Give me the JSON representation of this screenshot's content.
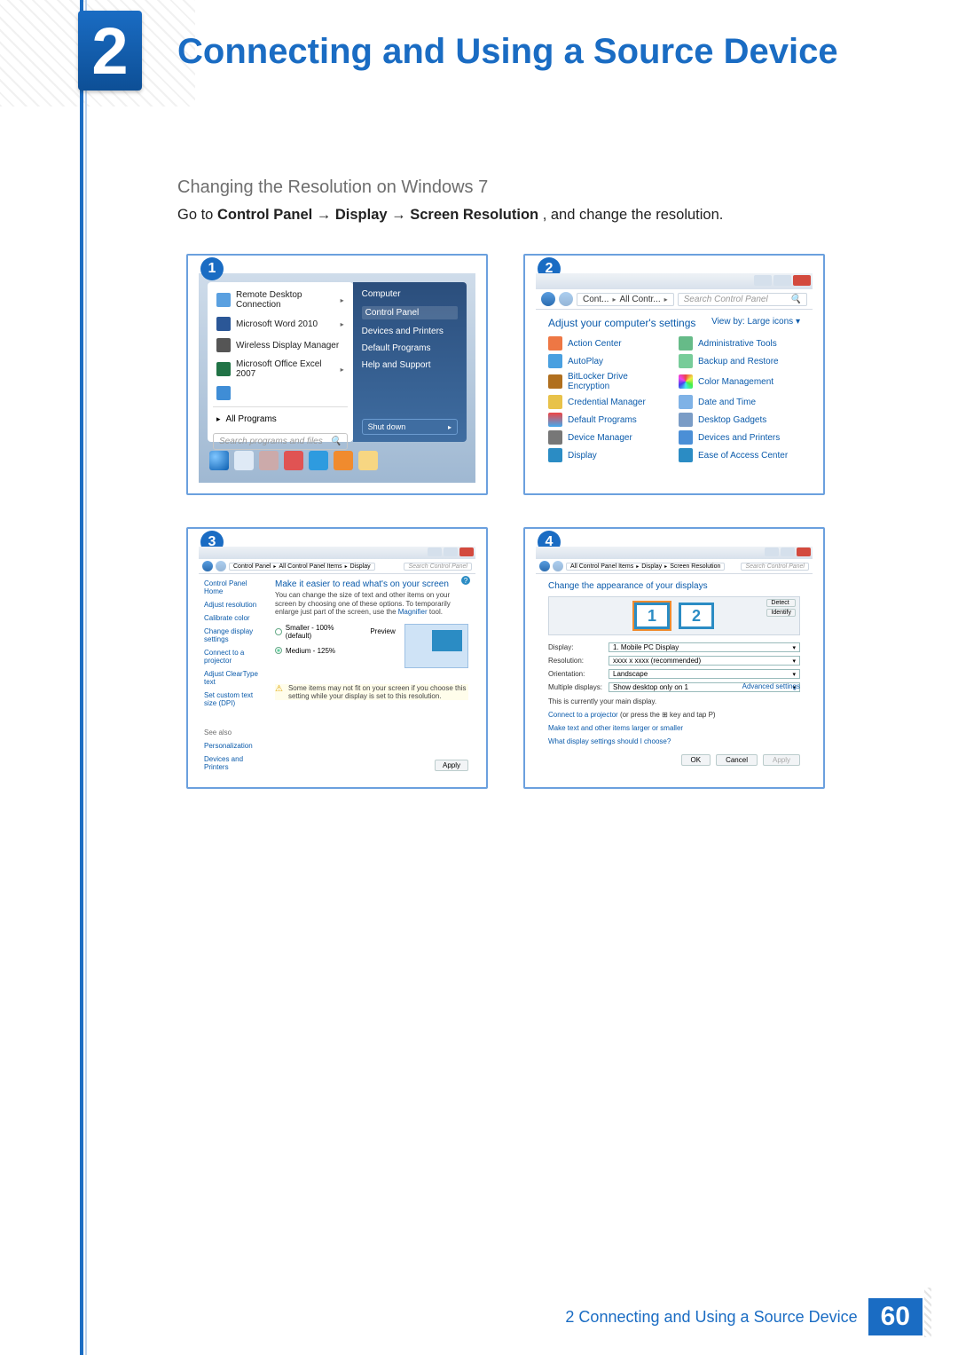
{
  "chapter": {
    "number": "2",
    "title": "Connecting and Using a Source Device"
  },
  "section": {
    "heading": "Changing the Resolution on Windows 7",
    "instruction_prefix": "Go to ",
    "instruction_bold": "Control Panel → Display → Screen Resolution",
    "instruction_suffix": ", and change the resolution."
  },
  "steps": {
    "s1": {
      "num": "1",
      "menu_items": [
        "Remote Desktop Connection",
        "Microsoft Word 2010",
        "Wireless Display Manager",
        "Microsoft Office Excel 2007"
      ],
      "all_programs": "All Programs",
      "search_placeholder": "Search programs and files",
      "right_items": [
        "Computer",
        "Control Panel",
        "Devices and Printers",
        "Default Programs",
        "Help and Support"
      ],
      "shutdown": "Shut down"
    },
    "s2": {
      "num": "2",
      "path": [
        "Cont...",
        "All Contr..."
      ],
      "search_placeholder": "Search Control Panel",
      "title": "Adjust your computer's settings",
      "view_label": "View by:",
      "view_value": "Large icons",
      "items": [
        "Action Center",
        "Administrative Tools",
        "AutoPlay",
        "Backup and Restore",
        "BitLocker Drive Encryption",
        "Color Management",
        "Credential Manager",
        "Date and Time",
        "Default Programs",
        "Desktop Gadgets",
        "Device Manager",
        "Devices and Printers",
        "Display",
        "Ease of Access Center"
      ]
    },
    "s3": {
      "num": "3",
      "path": [
        "Control Panel",
        "All Control Panel Items",
        "Display"
      ],
      "search_placeholder": "Search Control Panel",
      "side_home": "Control Panel Home",
      "side_links": [
        "Adjust resolution",
        "Calibrate color",
        "Change display settings",
        "Connect to a projector",
        "Adjust ClearType text",
        "Set custom text size (DPI)"
      ],
      "see_also": "See also",
      "see_links": [
        "Personalization",
        "Devices and Printers"
      ],
      "main_title": "Make it easier to read what's on your screen",
      "main_desc_a": "You can change the size of text and other items on your screen by choosing one of these options. To temporarily enlarge just part of the screen, use the ",
      "main_desc_link": "Magnifier",
      "main_desc_b": " tool.",
      "opt_small": "Smaller - 100% (default)",
      "preview_label": "Preview",
      "opt_medium": "Medium - 125%",
      "note": "Some items may not fit on your screen if you choose this setting while your display is set to this resolution.",
      "apply": "Apply"
    },
    "s4": {
      "num": "4",
      "path": [
        "All Control Panel Items",
        "Display",
        "Screen Resolution"
      ],
      "search_placeholder": "Search Control Panel",
      "title": "Change the appearance of your displays",
      "detect": "Detect",
      "identify": "Identify",
      "mon1": "1",
      "mon2": "2",
      "lbl_display": "Display:",
      "val_display": "1. Mobile PC Display",
      "lbl_res": "Resolution:",
      "val_res": "xxxx x xxxx   (recommended)",
      "lbl_orient": "Orientation:",
      "val_orient": "Landscape",
      "lbl_multi": "Multiple displays:",
      "val_multi": "Show desktop only on 1",
      "main_line": "This is currently your main display.",
      "adv": "Advanced settings",
      "proj_a": "Connect to a projector",
      "proj_b": " (or press the ⊞ key and tap P)",
      "larger": "Make text and other items larger or smaller",
      "what": "What display settings should I choose?",
      "btn_ok": "OK",
      "btn_cancel": "Cancel",
      "btn_apply": "Apply"
    }
  },
  "footer": {
    "text": "2 Connecting and Using a Source Device",
    "page": "60"
  }
}
